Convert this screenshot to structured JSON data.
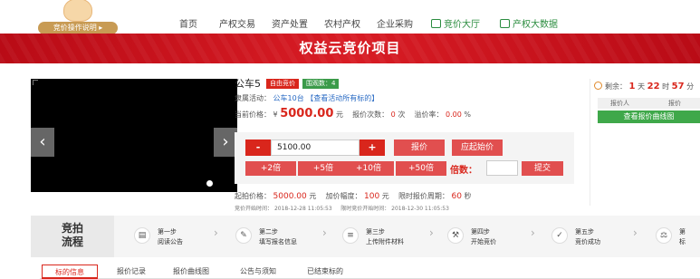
{
  "header": {
    "logo_button": "竞价操作说明",
    "nav": [
      {
        "label": "首页"
      },
      {
        "label": "产权交易"
      },
      {
        "label": "资产处置"
      },
      {
        "label": "农村产权"
      },
      {
        "label": "企业采购"
      },
      {
        "label": "竞价大厅"
      },
      {
        "label": "产权大数据"
      }
    ]
  },
  "banner": {
    "title": "权益云竞价项目"
  },
  "item": {
    "title": "公车5",
    "tag_mode": "自由竞价",
    "tag_views": "围观数：4",
    "activity_label": "隶属活动：",
    "activity_name": "公车10台",
    "activity_link": "【查看活动所有标的】",
    "current_label": "当前价格：",
    "currency": "¥",
    "current_price": "5000.00",
    "current_unit": "元",
    "bids_label": "报价次数：",
    "bids_value": "0",
    "bids_unit": "次",
    "premium_label": "溢价率：",
    "premium_value": "0.00",
    "premium_unit": "%"
  },
  "bid": {
    "minus": "-",
    "amount": "5100.00",
    "plus": "+",
    "submit_bid": "报价",
    "reserve_bid": "应起始价",
    "multipliers": [
      "+2倍",
      "+5倍",
      "+10倍",
      "+50倍"
    ],
    "multiple_label": "倍数：",
    "multiple_value": "",
    "submit": "提交"
  },
  "terms": {
    "start_label": "起拍价格：",
    "start_price": "5000.00",
    "start_unit": "元",
    "increment_label": "加价幅度：",
    "increment_value": "100",
    "increment_unit": "元",
    "period_label": "限时报价周期：",
    "period_value": "60",
    "period_unit": "秒",
    "begin_label": "竞价开始时间：",
    "begin_time": "2018-12-28 11:05:53",
    "limit_label": "限时竞价开始时间：",
    "limit_time": "2018-12-30 11:05:53"
  },
  "countdown": {
    "label": "剩余：",
    "days": "1",
    "days_unit": "天",
    "hours": "22",
    "hours_unit": "时",
    "minutes": "57",
    "minutes_unit": "分"
  },
  "bidders": {
    "col1": "报价人",
    "col2": "报价",
    "curve_button": "查看报价曲线图"
  },
  "process": {
    "title_line1": "竞拍",
    "title_line2": "流程",
    "steps": [
      {
        "t1": "第一步",
        "t2": "阅读公告"
      },
      {
        "t1": "第二步",
        "t2": "填写报名信息"
      },
      {
        "t1": "第三步",
        "t2": "上传附件材料"
      },
      {
        "t1": "第四步",
        "t2": "开始竞价"
      },
      {
        "t1": "第五步",
        "t2": "竞价成功"
      },
      {
        "t1": "第",
        "t2": "标"
      }
    ]
  },
  "tabs": [
    {
      "label": "标的信息"
    },
    {
      "label": "报价记录"
    },
    {
      "label": "报价曲线图"
    },
    {
      "label": "公告与须知"
    },
    {
      "label": "已结束标的"
    }
  ],
  "colors": {
    "brand_red": "#d9261c",
    "accent_green": "#3b9b4a",
    "link_blue": "#2a6bc4"
  }
}
